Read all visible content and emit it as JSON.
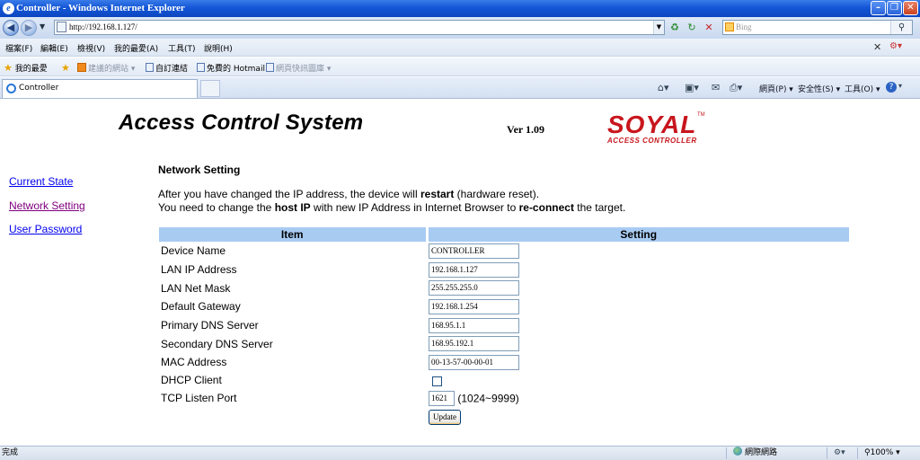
{
  "window": {
    "title": "Controller - Windows Internet Explorer",
    "app_icon_glyph": "e"
  },
  "nav": {
    "back_glyph": "◀",
    "forward_glyph": "▶",
    "address": "http://192.168.1.127/",
    "search_placeholder": "Bing",
    "search_glyph": "⚲",
    "stop_glyph": "✕"
  },
  "menu": {
    "items": [
      "檔案(F)",
      "編輯(E)",
      "檢視(V)",
      "我的最愛(A)",
      "工具(T)",
      "說明(H)"
    ]
  },
  "favorites": {
    "label": "我的最愛",
    "items": [
      "建議的網站 ▾",
      "自訂連結",
      "免費的 Hotmail",
      "網頁快訊圖庫 ▾"
    ]
  },
  "tabs": {
    "active_label": "Controller"
  },
  "commands": {
    "page": "網頁(P) ▾",
    "safety": "安全性(S) ▾",
    "tools": "工具(O) ▾",
    "help_glyph": "?"
  },
  "page": {
    "title": "Access Control System",
    "version": "Ver 1.09",
    "logo": {
      "word": "SOYAL",
      "tm": "TM",
      "sub": "ACCESS CONTROLLER"
    },
    "sidebar": [
      {
        "label": "Current State"
      },
      {
        "label": "Network Setting"
      },
      {
        "label": "User Password"
      }
    ],
    "section_title": "Network Setting",
    "notice": {
      "line1_a": "After you have changed the IP address, the device will ",
      "line1_b": "restart",
      "line1_c": " (hardware reset).",
      "line2_a": "You need to change the ",
      "line2_b": "host IP",
      "line2_c": " with new IP Address in Internet Browser to ",
      "line2_d": "re-connect",
      "line2_e": " the target."
    },
    "table": {
      "header_item": "Item",
      "header_setting": "Setting",
      "rows": [
        {
          "label": "Device Name",
          "value": "CONTROLLER"
        },
        {
          "label": "LAN IP Address",
          "value": "192.168.1.127"
        },
        {
          "label": "LAN Net Mask",
          "value": "255.255.255.0"
        },
        {
          "label": "Default Gateway",
          "value": "192.168.1.254"
        },
        {
          "label": "Primary DNS Server",
          "value": "168.95.1.1"
        },
        {
          "label": "Secondary DNS Server",
          "value": "168.95.192.1"
        },
        {
          "label": "MAC Address",
          "value": "00-13-57-00-00-01"
        },
        {
          "label": "DHCP Client",
          "checked": false
        },
        {
          "label": "TCP Listen Port",
          "value": "1621",
          "range": "(1024~9999)"
        }
      ],
      "update_label": "Update"
    }
  },
  "status": {
    "text": "完成",
    "zone": "網際網路",
    "zoom": "100% ▾"
  },
  "colors": {
    "table_header": "#a8cbf2",
    "logo": "#c8161d",
    "link": "#0000ee",
    "visited_link": "#800080"
  }
}
